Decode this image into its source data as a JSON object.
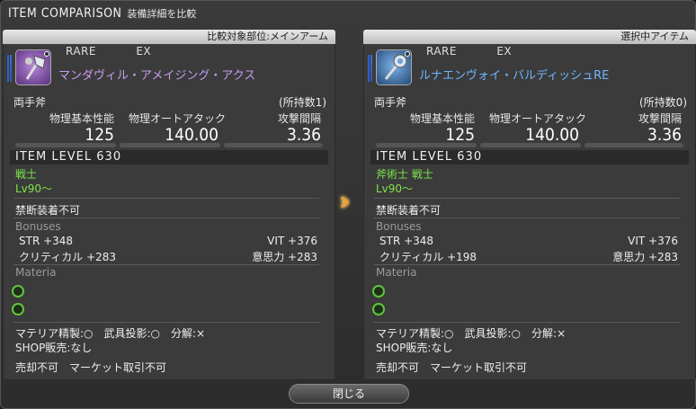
{
  "window": {
    "title": "ITEM COMPARISON",
    "subtitle": "装備詳細を比較"
  },
  "left": {
    "header": "比較対象部位:メインアーム",
    "rarity": [
      "RARE",
      "EX"
    ],
    "icon": "axe-icon",
    "name": "マンダヴィル・アメイジング・アクス",
    "category": "両手斧",
    "owned": "(所持数1)",
    "stat_labels": [
      "物理基本性能",
      "物理オートアタック",
      "攻撃間隔"
    ],
    "stat_values": [
      "125",
      "140.00",
      "3.36"
    ],
    "ilvl": "ITEM LEVEL 630",
    "job": "戦士",
    "level": "Lv90～",
    "unique": "禁断装着不可",
    "bonuses_title": "Bonuses",
    "bonuses": [
      {
        "l": "STR +348",
        "r": "VIT +376"
      },
      {
        "l": "クリティカル +283",
        "r": "意思力 +283"
      }
    ],
    "materia_title": "Materia",
    "misc1": "マテリア精製:○　武具投影:○　分解:×",
    "misc2": "SHOP販売:なし",
    "misc3": "売却不可　マーケット取引不可"
  },
  "right": {
    "header": "選択中アイテム",
    "rarity": [
      "RARE",
      "EX"
    ],
    "icon": "hammer-icon",
    "name": "ルナエンヴォイ・バルディッシュRE",
    "category": "両手斧",
    "owned": "(所持数0)",
    "stat_labels": [
      "物理基本性能",
      "物理オートアタック",
      "攻撃間隔"
    ],
    "stat_values": [
      "125",
      "140.00",
      "3.36"
    ],
    "ilvl": "ITEM LEVEL 630",
    "job": "斧術士 戦士",
    "level": "Lv90～",
    "unique": "禁断装着不可",
    "bonuses_title": "Bonuses",
    "bonuses": [
      {
        "l": "STR +348",
        "r": "VIT +376"
      },
      {
        "l": "クリティカル +198",
        "r": "意思力 +283"
      }
    ],
    "materia_title": "Materia",
    "misc1": "マテリア精製:○　武具投影:○　分解:×",
    "misc2": "SHOP販売:なし",
    "misc3": "売却不可　マーケット取引不可"
  },
  "close_label": "閉じる",
  "colors": {
    "accent_green": "#7ee44a",
    "name_purple": "#c79cf0",
    "name_blue": "#6fb6ff",
    "arrow": "#e8a23a"
  }
}
